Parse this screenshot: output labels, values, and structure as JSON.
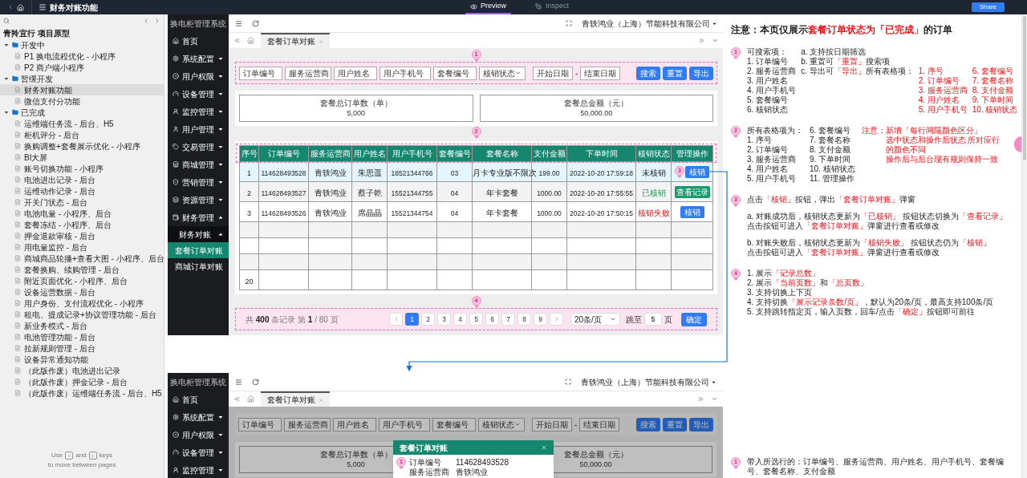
{
  "topbar": {
    "title": "财务对账功能",
    "modes": [
      {
        "label": "Preview",
        "kind": "preview",
        "selected": true
      },
      {
        "label": "Inspect",
        "kind": "inspect",
        "selected": false
      }
    ],
    "share": "Share"
  },
  "pages_panel": {
    "project": "青羚宜行 项目原型",
    "tree": [
      {
        "kind": "folder",
        "label": "开发中",
        "expanded": true,
        "children": [
          {
            "kind": "page",
            "label": "P1 换电流程优化 - 小程序",
            "selected": false
          },
          {
            "kind": "page",
            "label": "P2 商户端小程序",
            "selected": false
          }
        ]
      },
      {
        "kind": "folder",
        "label": "暂缓开发",
        "expanded": true,
        "children": [
          {
            "kind": "page",
            "label": "财务对账功能",
            "selected": true
          },
          {
            "kind": "page",
            "label": "微信支付分功能",
            "selected": false
          }
        ]
      },
      {
        "kind": "folder",
        "label": "已完成",
        "expanded": true,
        "children": [
          {
            "kind": "page",
            "label": "运维端任务流 - 后台、H5",
            "selected": false
          },
          {
            "kind": "page",
            "label": "柜机评分 - 后台",
            "selected": false
          },
          {
            "kind": "page",
            "label": "换购调整+套餐展示优化 - 小程序",
            "selected": false
          },
          {
            "kind": "page",
            "label": "BI大屏",
            "selected": false
          },
          {
            "kind": "page",
            "label": "账号切换功能 - 小程序",
            "selected": false
          },
          {
            "kind": "page",
            "label": "电池进出记录 - 后台",
            "selected": false
          },
          {
            "kind": "page",
            "label": "运维动作记录 - 后台",
            "selected": false
          },
          {
            "kind": "page",
            "label": "开关门状态 - 后台",
            "selected": false
          },
          {
            "kind": "page",
            "label": "电池电量 - 小程序、后台",
            "selected": false
          },
          {
            "kind": "page",
            "label": "套餐冻结 - 小程序、后台",
            "selected": false
          },
          {
            "kind": "page",
            "label": "押金退款审核 - 后台",
            "selected": false
          },
          {
            "kind": "page",
            "label": "用电量监控 - 后台",
            "selected": false
          },
          {
            "kind": "page",
            "label": "商城商品轮播+查看大图 - 小程序、后台",
            "selected": false
          },
          {
            "kind": "page",
            "label": "套餐换购、续购管理 - 后台",
            "selected": false
          },
          {
            "kind": "page",
            "label": "附近页面优化 - 小程序、后台",
            "selected": false
          },
          {
            "kind": "page",
            "label": "设备运营数据 - 后台",
            "selected": false
          },
          {
            "kind": "page",
            "label": "用户身份、支付流程优化 - 小程序",
            "selected": false
          },
          {
            "kind": "page",
            "label": "租电、提成记录+协议管理功能 - 后台",
            "selected": false
          },
          {
            "kind": "page",
            "label": "新业务模式 - 后台",
            "selected": false
          },
          {
            "kind": "page",
            "label": "电池管理功能 - 后台",
            "selected": false
          },
          {
            "kind": "page",
            "label": "拉新规则管理 - 后台",
            "selected": false
          },
          {
            "kind": "page",
            "label": "设备异常通知功能",
            "selected": false
          },
          {
            "kind": "page",
            "label": "（此版作废）电池进出记录",
            "selected": false
          },
          {
            "kind": "page",
            "label": "（此版作废）押金记录 - 后台",
            "selected": false
          },
          {
            "kind": "page",
            "label": "（此版作废）运维端任务流 - 后台、H5",
            "selected": false
          }
        ]
      }
    ],
    "hint": {
      "before": "Use",
      "between": "and",
      "after": "keys",
      "line2": "to move between pages"
    }
  },
  "preview_main": {
    "sidebar": {
      "title": "换电柜管理系统",
      "items": [
        {
          "label": "首页"
        },
        {
          "label": "系统配置",
          "expanded": false
        },
        {
          "label": "用户权限",
          "expanded": false
        },
        {
          "label": "设备管理",
          "expanded": false
        },
        {
          "label": "监控管理",
          "expanded": false
        },
        {
          "label": "用户管理",
          "expanded": false
        },
        {
          "label": "交易管理",
          "expanded": false
        },
        {
          "label": "商城管理",
          "expanded": false
        },
        {
          "label": "营销管理",
          "expanded": false
        },
        {
          "label": "资源管理",
          "expanded": false
        },
        {
          "label": "财务管理",
          "expanded": true,
          "children": [
            {
              "label": "财务对账",
              "expanded": true,
              "children": [
                {
                  "label": "套餐订单对账",
                  "selected": true
                },
                {
                  "label": "商城订单对账",
                  "selected": false
                }
              ]
            }
          ]
        }
      ]
    },
    "company": "青轶鸿业（上海）节能科技有限公司",
    "tabs": [
      {
        "label": "套餐订单对账",
        "selected": true
      }
    ],
    "filter": {
      "marker": "1",
      "fields": [
        {
          "kind": "input",
          "placeholder": "订单编号"
        },
        {
          "kind": "select",
          "placeholder": "服务运营商"
        },
        {
          "kind": "input",
          "placeholder": "用户姓名"
        },
        {
          "kind": "input",
          "placeholder": "用户手机号"
        },
        {
          "kind": "input",
          "placeholder": "套餐编号"
        },
        {
          "kind": "select",
          "placeholder": "核销状态"
        },
        {
          "kind": "date_range",
          "start_placeholder": "开始日期",
          "separator": "-",
          "end_placeholder": "结束日期"
        }
      ],
      "buttons": [
        "搜索",
        "重置",
        "导出"
      ]
    },
    "summary": [
      {
        "label": "套餐总订单数（单）",
        "value": "5,000"
      },
      {
        "label": "套餐总金额（元）",
        "value": "50,000.00"
      }
    ],
    "table": {
      "marker": "2",
      "columns": [
        "序号",
        "订单编号",
        "服务运营商",
        "用户姓名",
        "用户手机号",
        "套餐编号",
        "套餐名称",
        "支付金额",
        "下单时间",
        "核销状态",
        "管理操作"
      ],
      "rows": [
        {
          "index": "1",
          "selected": true,
          "cells": [
            "114628493528",
            "青轶鸿业",
            "朱思遥",
            "18521344766",
            "03",
            "月卡专业版不限次",
            "199.00",
            "2022-10-20 17:59:18"
          ],
          "status": {
            "text": "未核销",
            "kind": "pending"
          },
          "action": {
            "label": "核销",
            "kind": "verify"
          },
          "marker": "3"
        },
        {
          "index": "2",
          "selected": false,
          "cells": [
            "114628493527",
            "青轶鸿业",
            "蔡子乾",
            "15521344755",
            "04",
            "年卡套餐",
            "1000.00",
            "2022-10-20 17:55:55"
          ],
          "status": {
            "text": "已核销",
            "kind": "done"
          },
          "action": {
            "label": "查看记录",
            "kind": "records"
          }
        },
        {
          "index": "3",
          "selected": false,
          "cells": [
            "114628493526",
            "青轶鸿业",
            "席晶晶",
            "15521344754",
            "04",
            "年卡套餐",
            "1000.00",
            "2022-10-20 17:50:15"
          ],
          "status": {
            "text": "核销失败",
            "kind": "failed"
          },
          "action": {
            "label": "核销",
            "kind": "verify"
          }
        },
        {},
        {},
        {},
        {
          "index": "20",
          "selected": false
        }
      ]
    },
    "pagination": {
      "marker": "4",
      "summary": "共 **400** 条记录 第 **1** / 80 页",
      "pages": [
        {
          "label": "1",
          "selected": true
        },
        {
          "label": "2",
          "selected": false
        },
        {
          "label": "3",
          "selected": false
        },
        {
          "label": "4",
          "selected": false
        },
        {
          "label": "5",
          "selected": false
        },
        {
          "label": "6",
          "selected": false
        },
        {
          "label": "7",
          "selected": false
        },
        {
          "label": "8",
          "selected": false
        },
        {
          "label": "9",
          "selected": false
        }
      ],
      "page_size": "20条/页",
      "jump_label": "跳至",
      "jump_value": "5",
      "jump_unit": "页",
      "confirm": "确定"
    }
  },
  "preview_modal": {
    "sidebar": {
      "title": "换电柜管理系统",
      "items": [
        {
          "label": "首页"
        },
        {
          "label": "系统配置",
          "expanded": false
        },
        {
          "label": "用户权限",
          "expanded": false
        },
        {
          "label": "设备管理",
          "expanded": false
        },
        {
          "label": "监控管理",
          "expanded": false
        }
      ]
    },
    "company": "青轶鸿业（上海）节能科技有限公司",
    "tabs": [
      {
        "label": "套餐订单对账",
        "selected": true
      }
    ],
    "filter": {
      "fields": [
        {
          "kind": "input",
          "placeholder": "订单编号"
        },
        {
          "kind": "select",
          "placeholder": "服务运营商"
        },
        {
          "kind": "input",
          "placeholder": "用户姓名"
        },
        {
          "kind": "input",
          "placeholder": "用户手机号"
        },
        {
          "kind": "input",
          "placeholder": "套餐编号"
        },
        {
          "kind": "select",
          "placeholder": "核销状态"
        },
        {
          "kind": "date_range",
          "start_placeholder": "开始日期",
          "separator": "-",
          "end_placeholder": "结束日期"
        }
      ],
      "buttons": [
        "搜索",
        "重置",
        "导出"
      ]
    },
    "summary": [
      {
        "label": "套餐总订单数（单）",
        "value": "5,000"
      },
      {
        "label": "套餐总金额（元）",
        "value": "50,000.00"
      }
    ],
    "modal": {
      "title": "套餐订单对账",
      "marker": "1",
      "fields": [
        {
          "label": "订单编号",
          "value": "114628493528"
        },
        {
          "label": "服务运营商",
          "value": "青轶鸿业"
        }
      ]
    }
  },
  "notes": {
    "title": [
      {
        "text": "注意：本页仅展示",
        "red": false
      },
      {
        "text": "套餐订单状态为「已完成」",
        "red": true
      },
      {
        "text": "的订单",
        "red": false
      }
    ],
    "items": [
      {
        "kind": "search",
        "marker": "1",
        "fields": [
          "可搜索项：",
          "1. 订单编号",
          "2. 服务运营商",
          "3. 用户姓名",
          "4. 用户手机号",
          "5. 套餐编号",
          "6. 核销状态"
        ],
        "options": [
          "a. 支持按日期筛选",
          [
            {
              "text": "b. 重置可",
              "red": false
            },
            {
              "text": "「重置」",
              "red": true
            },
            {
              "text": "搜索项",
              "red": false
            }
          ]
        ],
        "export": {
          "label": [
            {
              "text": "c. 导出可",
              "red": false
            },
            {
              "text": "「导出」",
              "red": true
            },
            {
              "text": "所有表格项：",
              "red": false
            }
          ],
          "columns": [
            [
              "1. 序号",
              "2. 订单编号",
              "3. 服务运营商",
              "4. 用户姓名",
              "5. 用户手机号"
            ],
            [
              "6. 套餐编号",
              "7. 套餐名称",
              "8. 支付金额",
              "9. 下单时间",
              "10. 核销状态"
            ]
          ]
        }
      },
      {
        "kind": "columns",
        "marker": "2",
        "columns": [
          [
            "所有表格项为：",
            "1. 序号",
            "2. 订单编号",
            "3. 服务运营商",
            "4. 用户姓名",
            "5. 用户手机号"
          ],
          [
            "6. 套餐编号",
            "7. 套餐名称",
            "8. 支付金额",
            "9. 下单时间",
            "10. 核销状态",
            "11. 管理操作"
          ]
        ],
        "remark": [
          "注意：新增「每行间隔颜色区分」",
          "选中状态和操作后状态 所对应行的颜色不同",
          "操作后与后台现有规则保持一致"
        ]
      },
      {
        "kind": "paragraphs",
        "marker": "3",
        "paragraphs": [
          [
            [
              {
                "text": "点击",
                "red": false
              },
              {
                "text": "「核销」",
                "red": true
              },
              {
                "text": "按钮，弹出",
                "red": false
              },
              {
                "text": "「套餐订单对账」",
                "red": true
              },
              {
                "text": "弹窗",
                "red": false
              }
            ]
          ],
          [
            [
              {
                "text": "a. 对账成功后，核销状态更新为",
                "red": false
              },
              {
                "text": "「已核销」",
                "red": true
              },
              {
                "text": " 按钮状态切换为",
                "red": false
              },
              {
                "text": "「查看记录」",
                "red": true
              }
            ],
            [
              {
                "text": "点击按钮可进入",
                "red": false
              },
              {
                "text": "「套餐订单对账」",
                "red": true
              },
              {
                "text": "弹窗进行查看或修改",
                "red": false
              }
            ]
          ],
          [
            [
              {
                "text": "b. 对账失败后，核销状态更新为",
                "red": false
              },
              {
                "text": "「核销失败」",
                "red": true
              },
              {
                "text": " 按钮状态仍为",
                "red": false
              },
              {
                "text": "「核销」",
                "red": true
              }
            ],
            [
              {
                "text": "点击按钮可进入",
                "red": false
              },
              {
                "text": "「套餐订单对账」",
                "red": true
              },
              {
                "text": "弹窗进行查看或修改",
                "red": false
              }
            ]
          ]
        ]
      },
      {
        "kind": "paragraphs",
        "marker": "4",
        "paragraphs": [
          [
            [
              {
                "text": "1. 展示",
                "red": false
              },
              {
                "text": "「记录总数」",
                "red": true
              }
            ],
            [
              {
                "text": "2. 展示",
                "red": false
              },
              {
                "text": "「当前页数」",
                "red": true
              },
              {
                "text": "和",
                "red": false
              },
              {
                "text": "「总页数」",
                "red": true
              }
            ],
            "3. 支持切换上下页",
            [
              {
                "text": "4. 支持切换",
                "red": false
              },
              {
                "text": "「展示记录条数/页」",
                "red": true
              },
              {
                "text": "，默认为20条/页，最高支持100条/页",
                "red": false
              }
            ],
            [
              {
                "text": "5. 支持跳转指定页，输入页数，回车/点击",
                "red": false
              },
              {
                "text": "「确定」",
                "red": true
              },
              {
                "text": "按钮即可前往",
                "red": false
              }
            ]
          ]
        ]
      }
    ]
  },
  "modal_note": {
    "marker": "1",
    "text": "带入所选行的：订单编号、服务运营商、用户姓名、用户手机号、套餐编号、套餐名称、支付金额"
  }
}
